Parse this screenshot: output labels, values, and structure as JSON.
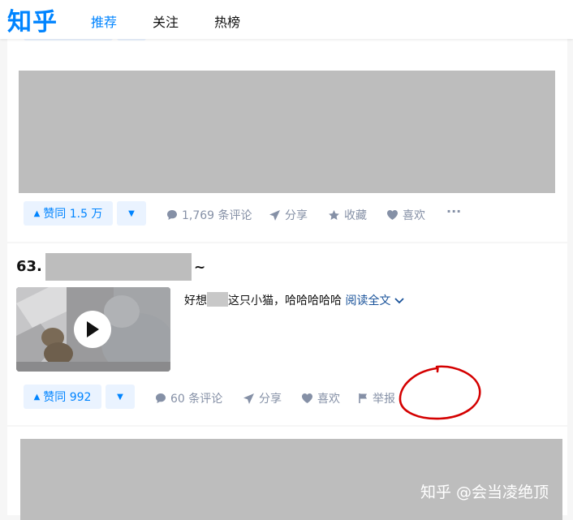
{
  "header": {
    "logo": "知乎",
    "tabs": [
      {
        "label": "推荐",
        "active": true
      },
      {
        "label": "关注",
        "active": false
      },
      {
        "label": "热榜",
        "active": false
      }
    ]
  },
  "answer_prev": {
    "vote_label": "赞同 1.5 万",
    "comments": "1,769 条评论",
    "share": "分享",
    "collect": "收藏",
    "like": "喜欢",
    "more": "···"
  },
  "answer_63": {
    "index": "63.",
    "title_tail": "~",
    "excerpt_start": "好想",
    "excerpt_end": "这只小猫，哈哈哈哈哈",
    "read_more": "阅读全文",
    "vote_label": "赞同 992",
    "comments": "60 条评论",
    "share": "分享",
    "like": "喜欢",
    "report": "举报"
  },
  "watermark": "知乎 @会当凌绝顶",
  "colors": {
    "brand": "#0084ff",
    "vote_bg": "#eaf3ff",
    "meta_gray": "#8590a6",
    "annotation_red": "#d40000"
  }
}
